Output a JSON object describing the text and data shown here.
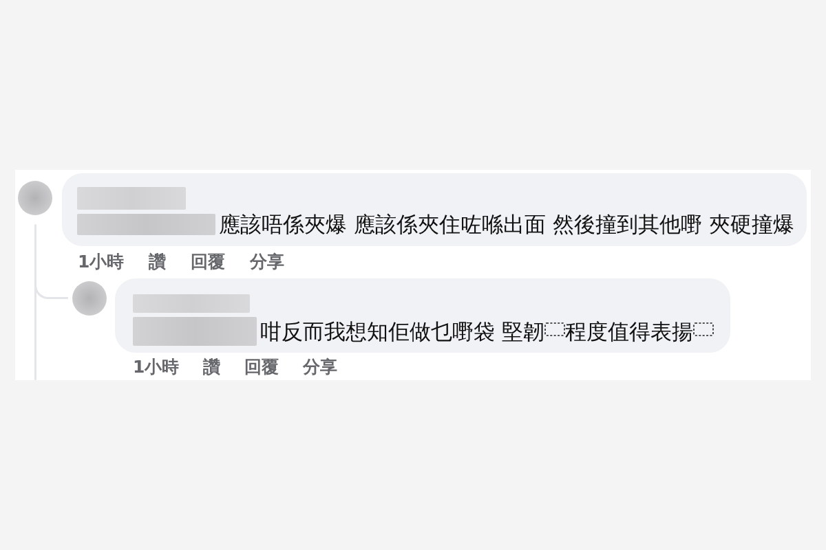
{
  "comments": [
    {
      "segments": [
        {
          "kind": "text",
          "text": "應該唔係夾爆 應該係夾住咗喺出面 然後撞到其他嘢 夾硬撞爆"
        }
      ],
      "time": "1小時",
      "actions": [
        "讚",
        "回覆",
        "分享"
      ],
      "replies": [
        {
          "segments": [
            {
              "kind": "text",
              "text": "咁反而我想知佢做乜嘢袋 堅韌"
            },
            {
              "kind": "object_mark"
            },
            {
              "kind": "text",
              "text": "程度值得表揚"
            },
            {
              "kind": "object_mark"
            }
          ],
          "time": "1小時",
          "actions": [
            "讚",
            "回覆",
            "分享"
          ]
        }
      ]
    }
  ]
}
